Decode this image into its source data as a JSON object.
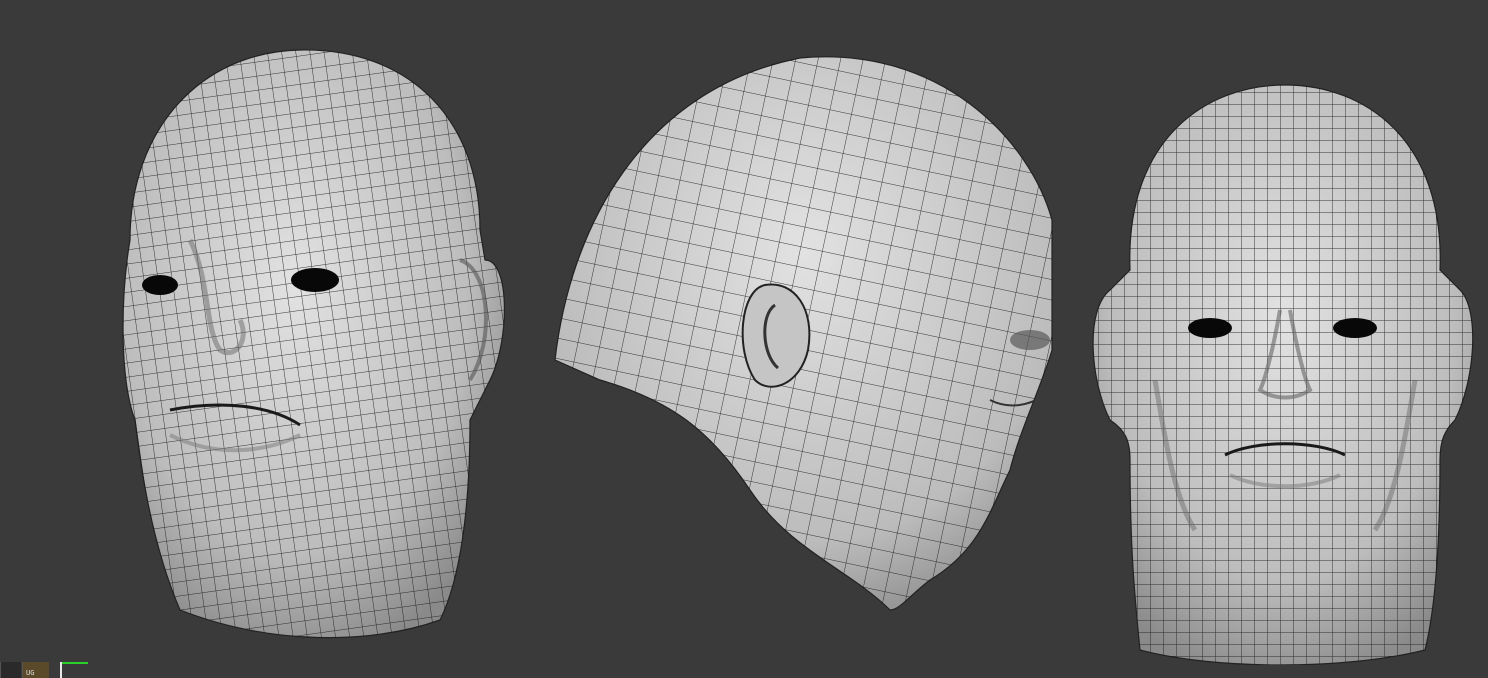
{
  "viewport": {
    "background": "#3a3a3a",
    "mesh_fill": "#c9c9c9",
    "wire_color": "#1a1a1a"
  },
  "views": [
    {
      "id": "three-quarter",
      "label": ""
    },
    {
      "id": "side",
      "label": ""
    },
    {
      "id": "front",
      "label": ""
    }
  ],
  "status": {
    "thumb_icon": "brush-stroke-icon",
    "thumb_text": "UG",
    "indicator_color": "#2bd12b"
  }
}
